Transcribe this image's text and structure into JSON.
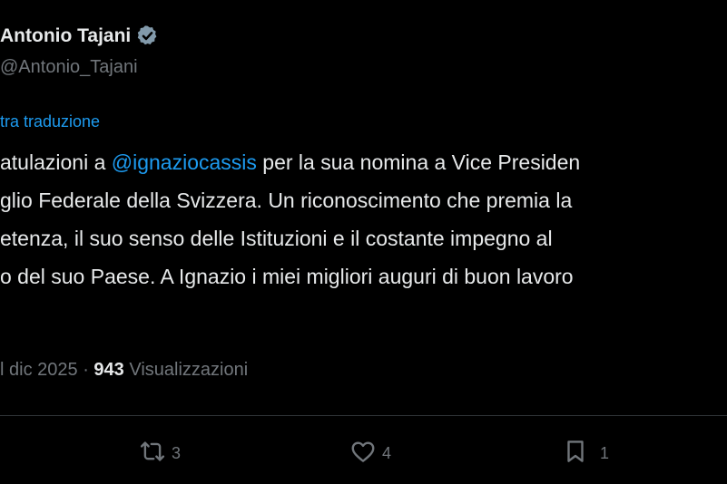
{
  "author": {
    "name": "Antonio Tajani",
    "handle": "@Antonio_Tajani"
  },
  "translate_link": "tra traduzione",
  "tweet": {
    "line1_before": "atulazioni a ",
    "mention": "@ignaziocassis",
    "line1_after": " per la sua nomina a Vice Presiden",
    "line2": "glio Federale della Svizzera. Un riconoscimento che premia la",
    "line3": "etenza, il suo senso delle Istituzioni e il costante impegno al",
    "line4": "o del suo Paese. A Ignazio i miei migliori auguri di buon lavoro"
  },
  "meta": {
    "date": "l dic 2025",
    "separator": "·",
    "views_count": "943",
    "views_label": "Visualizzazioni"
  },
  "actions": {
    "retweets": "3",
    "likes": "4",
    "bookmarks": "1"
  },
  "colors": {
    "background": "#000000",
    "text": "#e7e9ea",
    "secondary": "#71767b",
    "link": "#1d9bf0",
    "verified_badge": "#829aab"
  },
  "icons": [
    "verified-badge-icon",
    "retweet-icon",
    "heart-icon",
    "bookmark-icon"
  ]
}
